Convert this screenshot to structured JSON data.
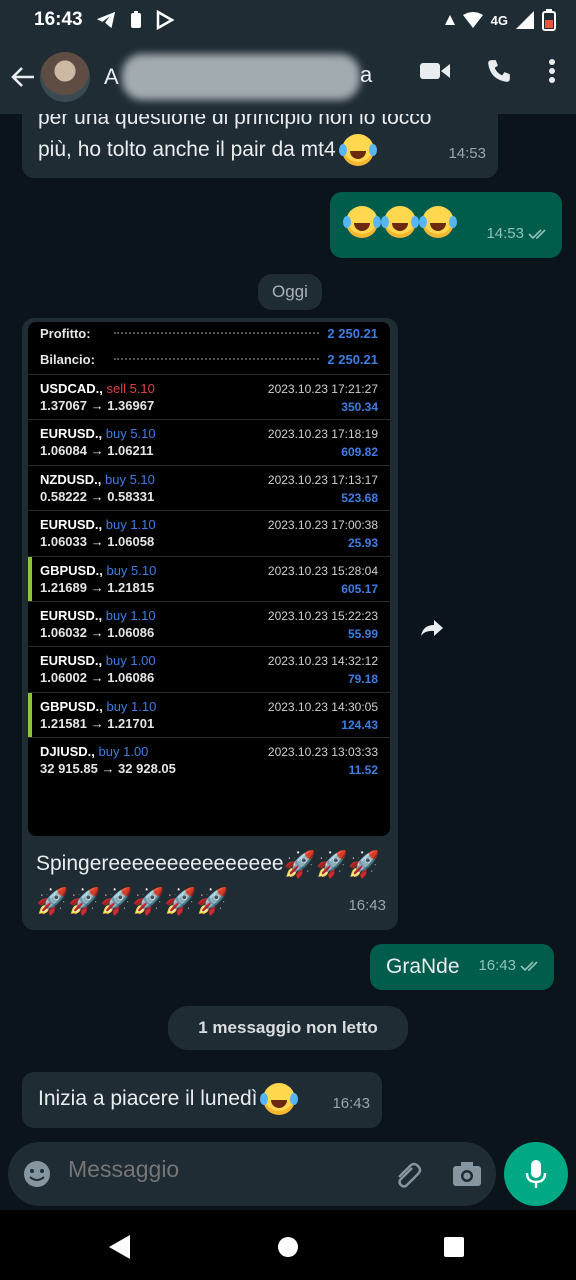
{
  "status": {
    "time": "16:43",
    "network": "4G"
  },
  "header": {
    "contact_initial": "A",
    "contact_tail": "a"
  },
  "messages": {
    "m1_line1": "per una questione di principio non lo tocco",
    "m1_line2": "più, ho tolto anche il pair da mt4",
    "m1_time": "14:53",
    "m2_time": "14:53",
    "day_label": "Oggi",
    "m3_text_line1": "Spingereeeeeeeeeeeeeee",
    "m3_time": "16:43",
    "m4_text": "GraNde",
    "m4_time": "16:43",
    "unread_label": "1 messaggio non letto",
    "m5_text": "Inizia a piacere il lunedì",
    "m5_time": "16:43"
  },
  "trading": {
    "summary": [
      {
        "label": "Profitto:",
        "value": "2 250.21"
      },
      {
        "label": "Bilancio:",
        "value": "2 250.21"
      }
    ],
    "trades": [
      {
        "symbol": "USDCAD.,",
        "side": "sell 5.10",
        "prices": "1.37067 → 1.36967",
        "date": "2023.10.23 17:21:27",
        "profit": "350.34"
      },
      {
        "symbol": "EURUSD.,",
        "side": "buy 5.10",
        "prices": "1.06084 → 1.06211",
        "date": "2023.10.23 17:18:19",
        "profit": "609.82"
      },
      {
        "symbol": "NZDUSD.,",
        "side": "buy 5.10",
        "prices": "0.58222 → 0.58331",
        "date": "2023.10.23 17:13:17",
        "profit": "523.68"
      },
      {
        "symbol": "EURUSD.,",
        "side": "buy 1.10",
        "prices": "1.06033 → 1.06058",
        "date": "2023.10.23 17:00:38",
        "profit": "25.93"
      },
      {
        "symbol": "GBPUSD.,",
        "side": "buy 5.10",
        "prices": "1.21689 → 1.21815",
        "date": "2023.10.23 15:28:04",
        "profit": "605.17"
      },
      {
        "symbol": "EURUSD.,",
        "side": "buy 1.10",
        "prices": "1.06032 → 1.06086",
        "date": "2023.10.23 15:22:23",
        "profit": "55.99"
      },
      {
        "symbol": "EURUSD.,",
        "side": "buy 1.00",
        "prices": "1.06002 → 1.06086",
        "date": "2023.10.23 14:32:12",
        "profit": "79.18"
      },
      {
        "symbol": "GBPUSD.,",
        "side": "buy 1.10",
        "prices": "1.21581 → 1.21701",
        "date": "2023.10.23 14:30:05",
        "profit": "124.43"
      },
      {
        "symbol": "DJIUSD.,",
        "side": "buy 1.00",
        "prices": "32 915.85 → 32 928.05",
        "date": "2023.10.23 13:03:33",
        "profit": "11.52"
      }
    ]
  },
  "input": {
    "placeholder": "Messaggio"
  },
  "colors": {
    "header": "#1f2c34",
    "outgoing": "#005c4b",
    "incoming": "#1f2c34",
    "accent": "#00a884"
  }
}
